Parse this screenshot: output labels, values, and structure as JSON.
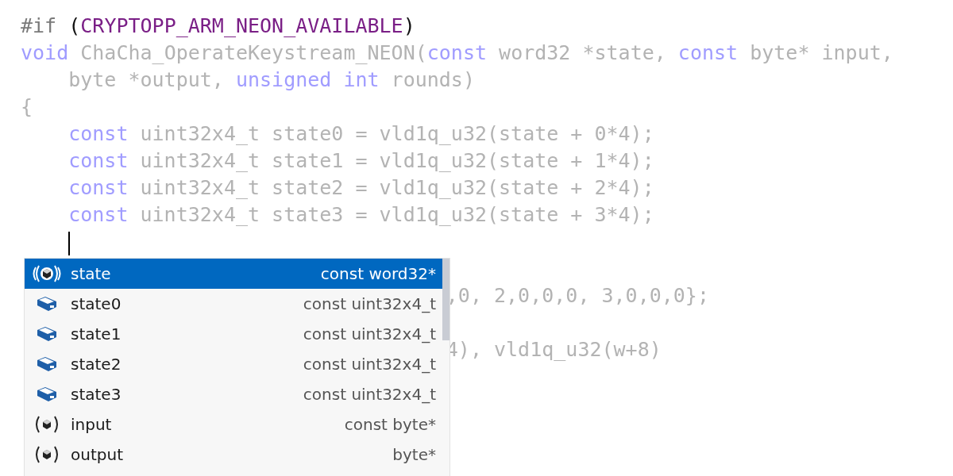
{
  "code_lines": [
    {
      "kind": "code",
      "tokens": [
        {
          "kind": "pp",
          "text": "#if "
        },
        {
          "kind": "punct",
          "text": "("
        },
        {
          "kind": "macro",
          "text": "CRYPTOPP_ARM_NEON_AVAILABLE"
        },
        {
          "kind": "punct",
          "text": ")"
        }
      ]
    },
    {
      "kind": "code",
      "tokens": [
        {
          "kind": "kw",
          "text": "void"
        },
        {
          "kind": "plain",
          "text": " ChaCha_OperateKeystream_NEON("
        },
        {
          "kind": "kw",
          "text": "const"
        },
        {
          "kind": "plain",
          "text": " word32 *state, "
        },
        {
          "kind": "kw",
          "text": "const"
        },
        {
          "kind": "plain",
          "text": " byte* input,"
        }
      ]
    },
    {
      "kind": "code",
      "tokens": [
        {
          "kind": "plain",
          "text": "    byte *output, "
        },
        {
          "kind": "kw",
          "text": "unsigned int"
        },
        {
          "kind": "plain",
          "text": " rounds)"
        }
      ]
    },
    {
      "kind": "code",
      "tokens": [
        {
          "kind": "plain",
          "text": "{"
        }
      ]
    },
    {
      "kind": "code",
      "tokens": [
        {
          "kind": "kw",
          "text": "    const"
        },
        {
          "kind": "plain",
          "text": " uint32x4_t state0 = vld1q_u32(state + 0*4);"
        }
      ]
    },
    {
      "kind": "code",
      "tokens": [
        {
          "kind": "kw",
          "text": "    const"
        },
        {
          "kind": "plain",
          "text": " uint32x4_t state1 = vld1q_u32(state + 1*4);"
        }
      ]
    },
    {
      "kind": "code",
      "tokens": [
        {
          "kind": "kw",
          "text": "    const"
        },
        {
          "kind": "plain",
          "text": " uint32x4_t state2 = vld1q_u32(state + 2*4);"
        }
      ]
    },
    {
      "kind": "code",
      "tokens": [
        {
          "kind": "kw",
          "text": "    const"
        },
        {
          "kind": "plain",
          "text": " uint32x4_t state3 = vld1q_u32(state + 3*4);"
        }
      ]
    },
    {
      "kind": "caret"
    },
    {
      "kind": "blank"
    },
    {
      "kind": "tail",
      "tokens": [
        {
          "kind": "plain",
          "text": ",0, 2,0,0,0, 3,0,0,0};"
        }
      ]
    },
    {
      "kind": "blank"
    },
    {
      "kind": "tail",
      "tokens": [
        {
          "kind": "plain",
          "text": "4), vld1q_u32(w+8)"
        }
      ]
    }
  ],
  "completion": {
    "items": [
      {
        "kind": "parameter",
        "name": "state",
        "type": "const word32*",
        "selected": true
      },
      {
        "kind": "variable",
        "name": "state0",
        "type": "const uint32x4_t",
        "selected": false
      },
      {
        "kind": "variable",
        "name": "state1",
        "type": "const uint32x4_t",
        "selected": false
      },
      {
        "kind": "variable",
        "name": "state2",
        "type": "const uint32x4_t",
        "selected": false
      },
      {
        "kind": "variable",
        "name": "state3",
        "type": "const uint32x4_t",
        "selected": false
      },
      {
        "kind": "parameter",
        "name": "input",
        "type": "const byte*",
        "selected": false
      },
      {
        "kind": "parameter",
        "name": "output",
        "type": "byte*",
        "selected": false
      }
    ]
  }
}
